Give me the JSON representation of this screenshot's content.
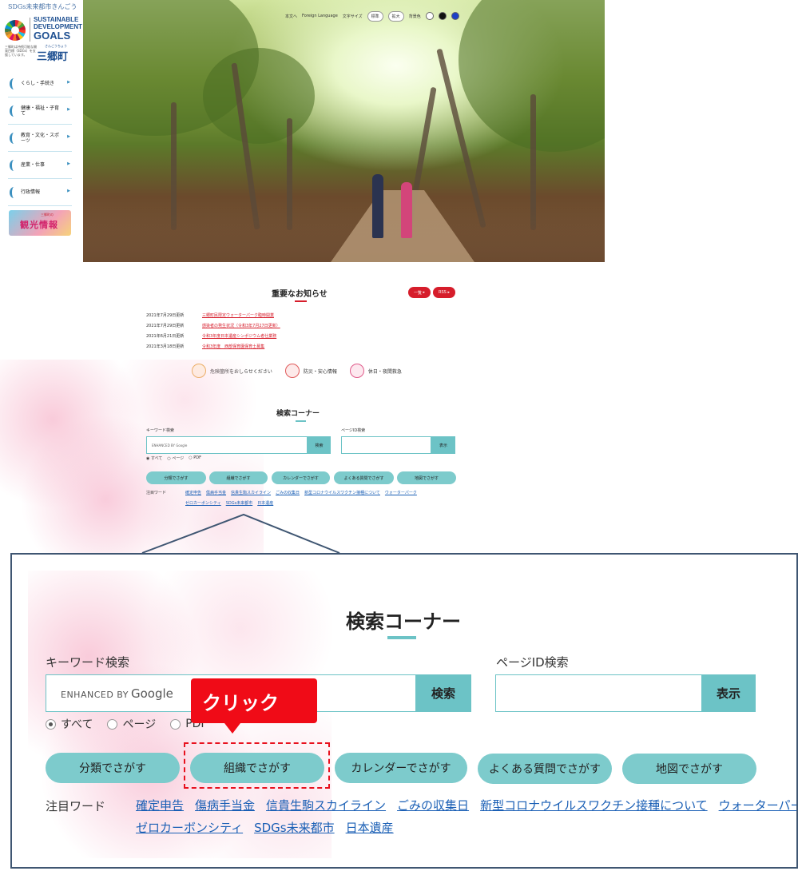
{
  "sidebar": {
    "sdgs_tagline": "SDGs未来都市きんごう",
    "sdgs_title_line1": "SUSTAINABLE",
    "sdgs_title_line2": "DEVELOPMENT",
    "sdgs_title_line3": "GOALS",
    "town_subtitle": "三郷町は持続可能な開発目標（SDGs）を支援しています。",
    "town_ruby": "さんごうちょう",
    "town_name": "三郷町",
    "menu": [
      {
        "label": "くらし・手続き"
      },
      {
        "label": "健康・福祉・子育て"
      },
      {
        "label": "教育・文化・スポーツ"
      },
      {
        "label": "産業・仕事"
      },
      {
        "label": "行政情報"
      }
    ],
    "tourism_banner": "観光情報",
    "tourism_sub": "三郷町の"
  },
  "utility": {
    "skip": "本文へ",
    "foreign": "Foreign Language",
    "font_size": "文字サイズ",
    "standard": "標準",
    "enlarge": "拡大",
    "bg_color": "背景色"
  },
  "news": {
    "title": "重要なお知らせ",
    "list_button": "一覧",
    "rss_button": "RSS",
    "items": [
      {
        "date": "2021年7月29日更新",
        "text": "三郷町民限定ウォーターパーク臨時開業"
      },
      {
        "date": "2021年7月29日更新",
        "text": "感染者の発生状況（令和3年7月27日更新）"
      },
      {
        "date": "2021年6月21日更新",
        "text": "令和3年度日本遺産シンポジウム者仕業務"
      },
      {
        "date": "2021年3月18日更新",
        "text": "令和3年度　西部保育園保育士募集"
      }
    ]
  },
  "info_bar": {
    "danger": "危険箇所をおしらせください",
    "disaster": "防災・安心情報",
    "holiday": "休日・夜間救急"
  },
  "search": {
    "title": "検索コーナー",
    "keyword_label": "キーワード検索",
    "google_prefix": "ENHANCED BY",
    "google_brand": "Google",
    "search_button": "検索",
    "page_id_label": "ページID検索",
    "display_button": "表示",
    "radios": [
      {
        "label": "すべて",
        "checked": true
      },
      {
        "label": "ページ",
        "checked": false
      },
      {
        "label": "PDF",
        "checked": false
      }
    ],
    "pills": [
      "分類でさがす",
      "組織でさがす",
      "カレンダーでさがす",
      "よくある質問でさがす",
      "地図でさがす"
    ],
    "keywords_label": "注目ワード",
    "keywords_row1": [
      "確定申告",
      "傷病手当金",
      "信貴生駒スカイライン",
      "ごみの収集日",
      "新型コロナウイルスワクチン接種について",
      "ウォーターパーク"
    ],
    "keywords_row2": [
      "ゼロカーボンシティ",
      "SDGs未来都市",
      "日本遺産"
    ]
  },
  "annotation": {
    "click_label": "クリック",
    "color": "#f00b17"
  },
  "colors": {
    "accent": "#6cc3c6",
    "pill": "#7dcbcc",
    "news_red": "#d61d2b",
    "link": "#1a5fb5",
    "frame": "#3f5672"
  }
}
